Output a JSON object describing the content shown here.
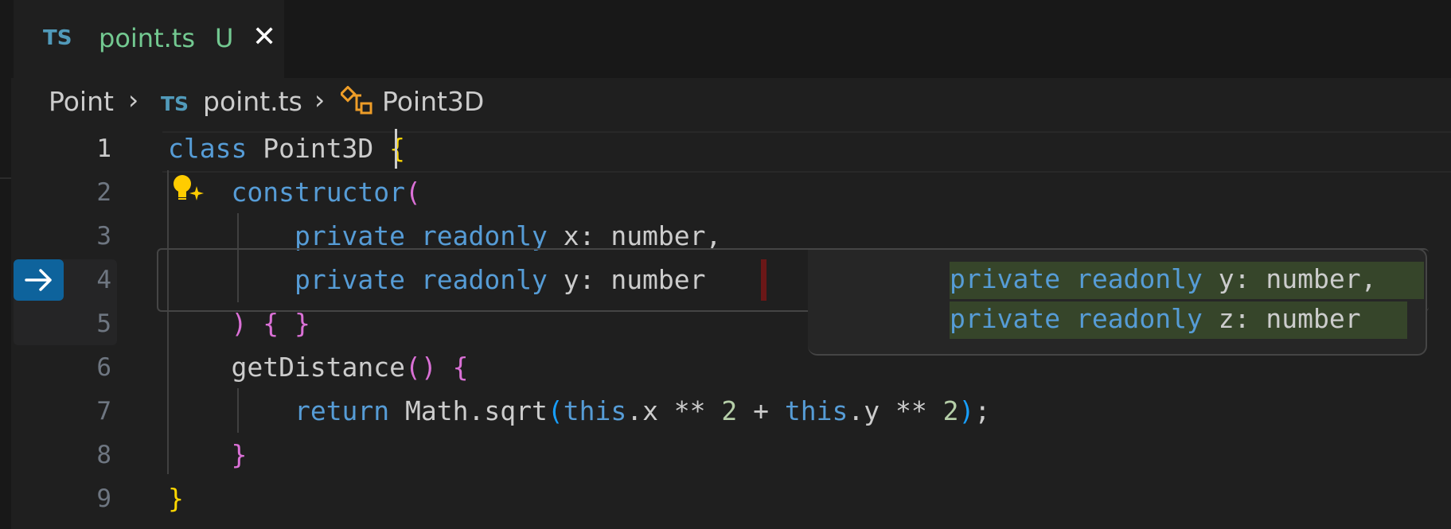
{
  "tab": {
    "lang_icon": "TS",
    "filename": "point.ts",
    "status": "U",
    "close_glyph": "✕"
  },
  "breadcrumb": {
    "folder": "Point",
    "sep1": "›",
    "file_icon": "TS",
    "file": "point.ts",
    "sep2": "›",
    "symbol_icon": "class-icon",
    "symbol": "Point3D"
  },
  "editor": {
    "line_numbers": [
      "1",
      "2",
      "3",
      "4",
      "5",
      "6",
      "7",
      "8",
      "9"
    ],
    "lines": [
      [
        {
          "t": "class ",
          "c": "kw"
        },
        {
          "t": "Point3D",
          "c": "cls"
        },
        {
          "t": " ",
          "c": "cls"
        },
        {
          "t": "{",
          "c": "br-gold"
        }
      ],
      [
        {
          "t": "    ",
          "c": "cls"
        },
        {
          "t": "constructor",
          "c": "kw"
        },
        {
          "t": "(",
          "c": "br-pink"
        }
      ],
      [
        {
          "t": "        ",
          "c": "cls"
        },
        {
          "t": "private ",
          "c": "kw"
        },
        {
          "t": "readonly ",
          "c": "kw"
        },
        {
          "t": "x: number,",
          "c": "cls"
        }
      ],
      [
        {
          "t": "        ",
          "c": "cls"
        },
        {
          "t": "private ",
          "c": "kw"
        },
        {
          "t": "readonly ",
          "c": "kw"
        },
        {
          "t": "y: number",
          "c": "cls"
        }
      ],
      [
        {
          "t": "    ",
          "c": "cls"
        },
        {
          "t": ") { }",
          "c": "br-pink"
        }
      ],
      [
        {
          "t": "    getDistance",
          "c": "cls"
        },
        {
          "t": "() {",
          "c": "br-pink"
        }
      ],
      [
        {
          "t": "        ",
          "c": "cls"
        },
        {
          "t": "return ",
          "c": "kw"
        },
        {
          "t": "Math.sqrt",
          "c": "cls"
        },
        {
          "t": "(",
          "c": "br-blue"
        },
        {
          "t": "this",
          "c": "kw"
        },
        {
          "t": ".x ** ",
          "c": "cls"
        },
        {
          "t": "2",
          "c": "num"
        },
        {
          "t": " + ",
          "c": "cls"
        },
        {
          "t": "this",
          "c": "kw"
        },
        {
          "t": ".y ** ",
          "c": "cls"
        },
        {
          "t": "2",
          "c": "num"
        },
        {
          "t": ")",
          "c": "br-blue"
        },
        {
          "t": ";",
          "c": "cls"
        }
      ],
      [
        {
          "t": "    ",
          "c": "cls"
        },
        {
          "t": "}",
          "c": "br-pink"
        }
      ],
      [
        {
          "t": "}",
          "c": "br-gold"
        }
      ]
    ]
  },
  "suggestion": {
    "lines": [
      [
        {
          "t": "private ",
          "c": "kw"
        },
        {
          "t": "readonly ",
          "c": "kw"
        },
        {
          "t": "y: number,",
          "c": "cls"
        }
      ],
      [
        {
          "t": "private ",
          "c": "kw"
        },
        {
          "t": "readonly ",
          "c": "kw"
        },
        {
          "t": "z: number",
          "c": "cls"
        }
      ]
    ]
  },
  "icons": {
    "gutter_action": "arrow-right-icon",
    "lightbulb": "lightbulb-sparkle-icon"
  },
  "colors": {
    "accent": "#0e639c",
    "keyword": "#569cd6",
    "added_highlight": "#36452a",
    "removed_marker": "#6b1717",
    "modified_file": "#73c991"
  }
}
